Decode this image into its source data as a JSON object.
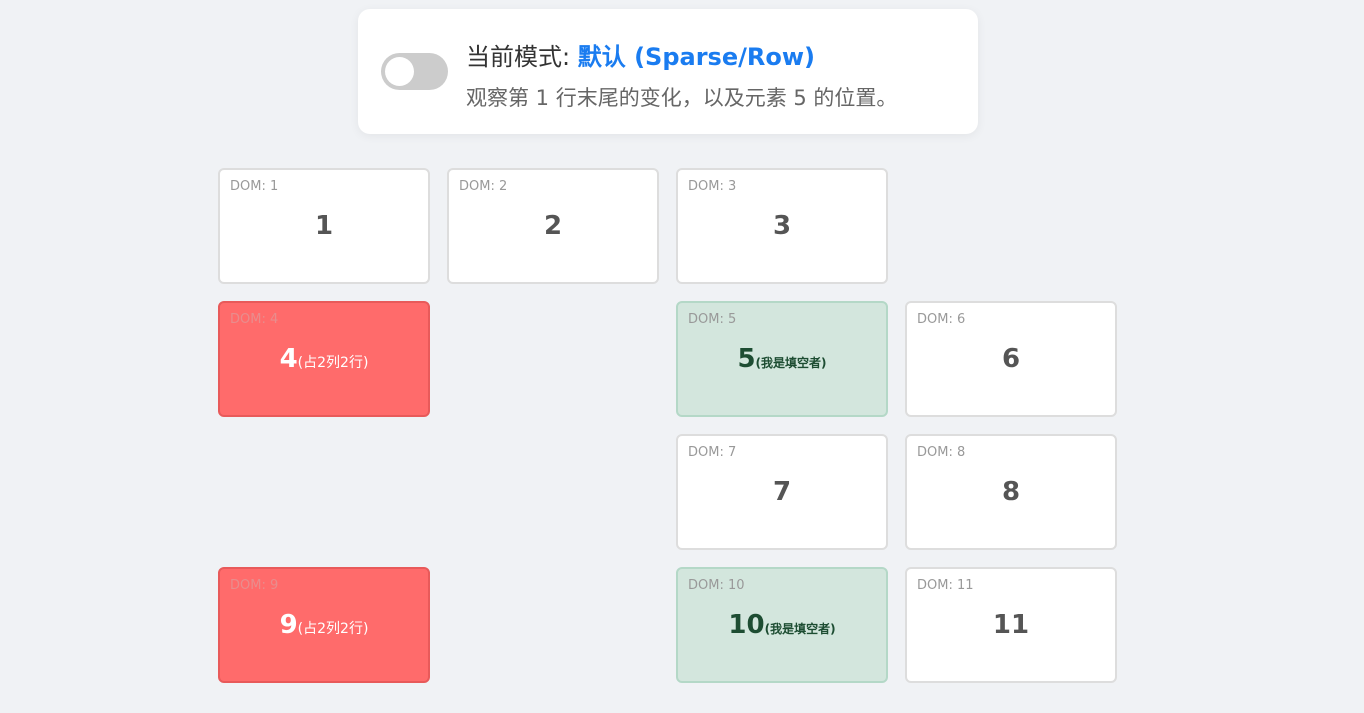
{
  "header": {
    "mode_prefix": "当前模式: ",
    "mode_value": "默认 (Sparse/Row)",
    "description": "观察第 1 行末尾的变化，以及元素 5 的位置。",
    "toggle_on": false
  },
  "colors": {
    "background": "#f0f2f5",
    "accent": "#1a7cf0",
    "big_item": "#ff6b6b",
    "filler_item": "#d3e6dd"
  },
  "items": [
    {
      "dom": "DOM: 1",
      "num": "1",
      "note": ""
    },
    {
      "dom": "DOM: 2",
      "num": "2",
      "note": ""
    },
    {
      "dom": "DOM: 3",
      "num": "3",
      "note": ""
    },
    {
      "dom": "DOM: 4",
      "num": "4",
      "note": "(占2列2行)"
    },
    {
      "dom": "DOM: 5",
      "num": "5",
      "note": "(我是填空者)"
    },
    {
      "dom": "DOM: 6",
      "num": "6",
      "note": ""
    },
    {
      "dom": "DOM: 7",
      "num": "7",
      "note": ""
    },
    {
      "dom": "DOM: 8",
      "num": "8",
      "note": ""
    },
    {
      "dom": "DOM: 9",
      "num": "9",
      "note": "(占2列2行)"
    },
    {
      "dom": "DOM: 10",
      "num": "10",
      "note": "(我是填空者)"
    },
    {
      "dom": "DOM: 11",
      "num": "11",
      "note": ""
    }
  ]
}
